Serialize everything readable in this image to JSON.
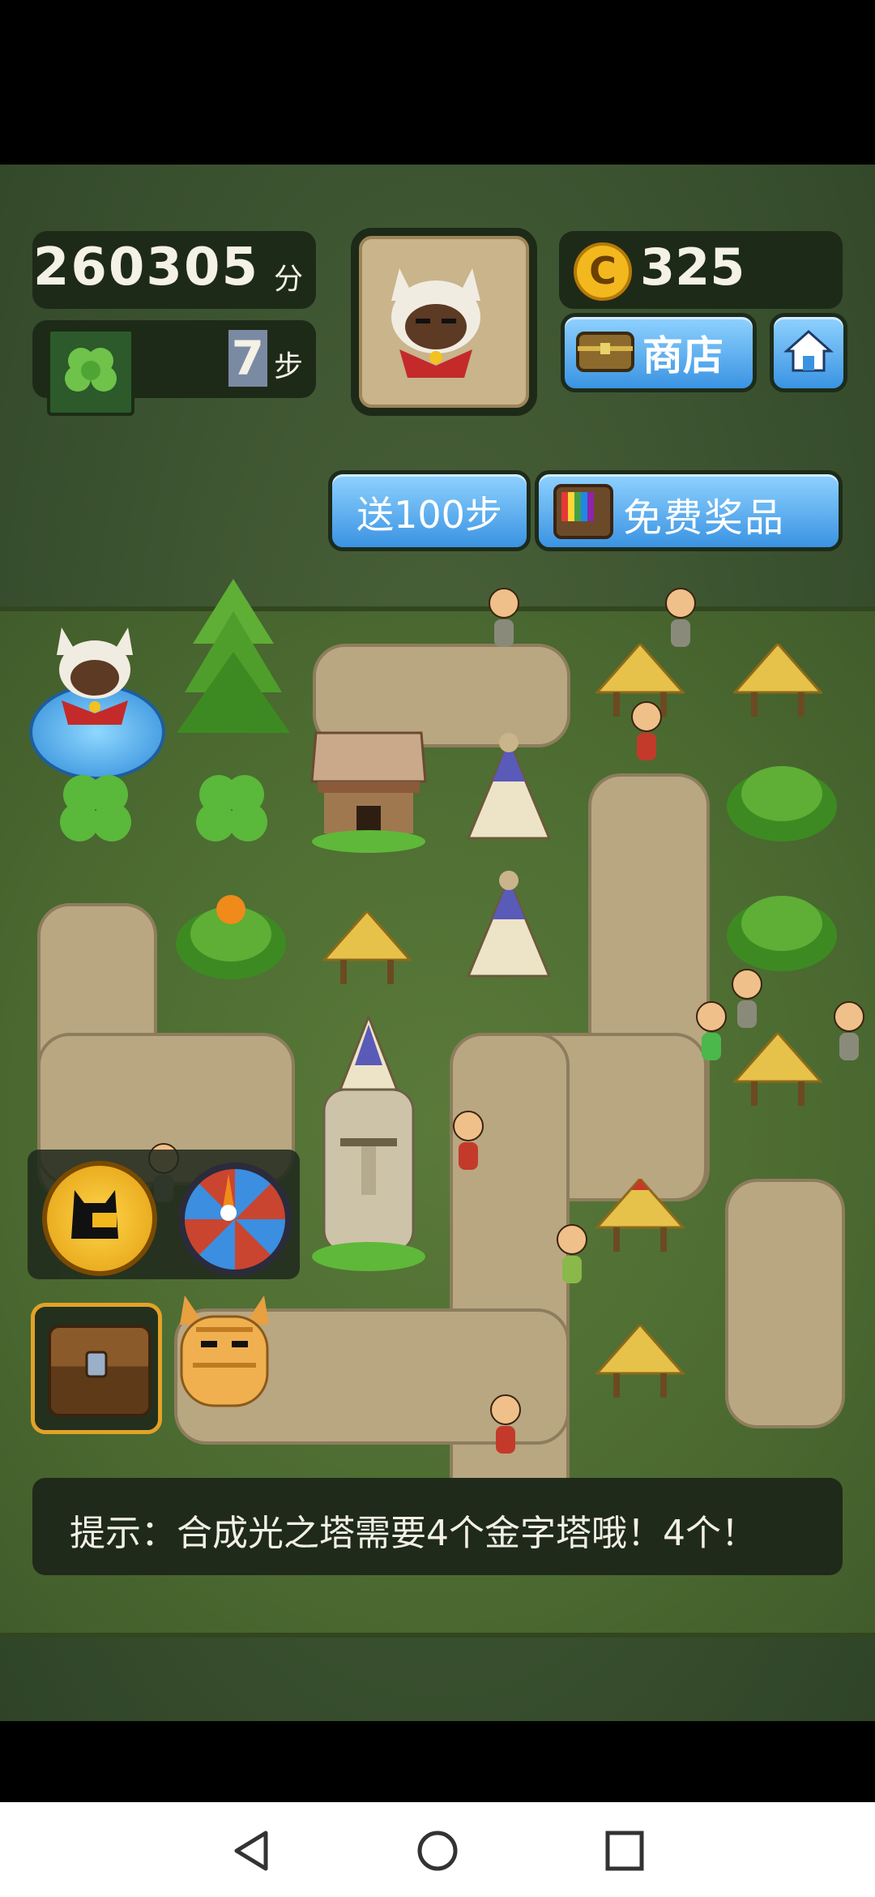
{
  "score": {
    "value": "260305",
    "unit": "分"
  },
  "steps": {
    "value": "7",
    "unit": "步",
    "icon": "clover-icon"
  },
  "coins": {
    "value": "325",
    "icon": "coin-icon"
  },
  "buttons": {
    "shop": "商店",
    "home": "home-icon",
    "send_steps": "送100步",
    "free_prize": "免费奖品"
  },
  "hint": "提示：合成光之塔需要4个金字塔哦！4个！",
  "avatar": "cat-avatar-icon",
  "tools": [
    "cat-coin-icon",
    "spin-wheel-icon",
    "treasure-chest-icon"
  ],
  "nav": [
    "back-icon",
    "home-circle-icon",
    "recent-apps-icon"
  ],
  "colors": {
    "board": "#4c6b31",
    "path": "#b9a782",
    "button": "#3a93e2",
    "coin": "#f2b81e"
  }
}
